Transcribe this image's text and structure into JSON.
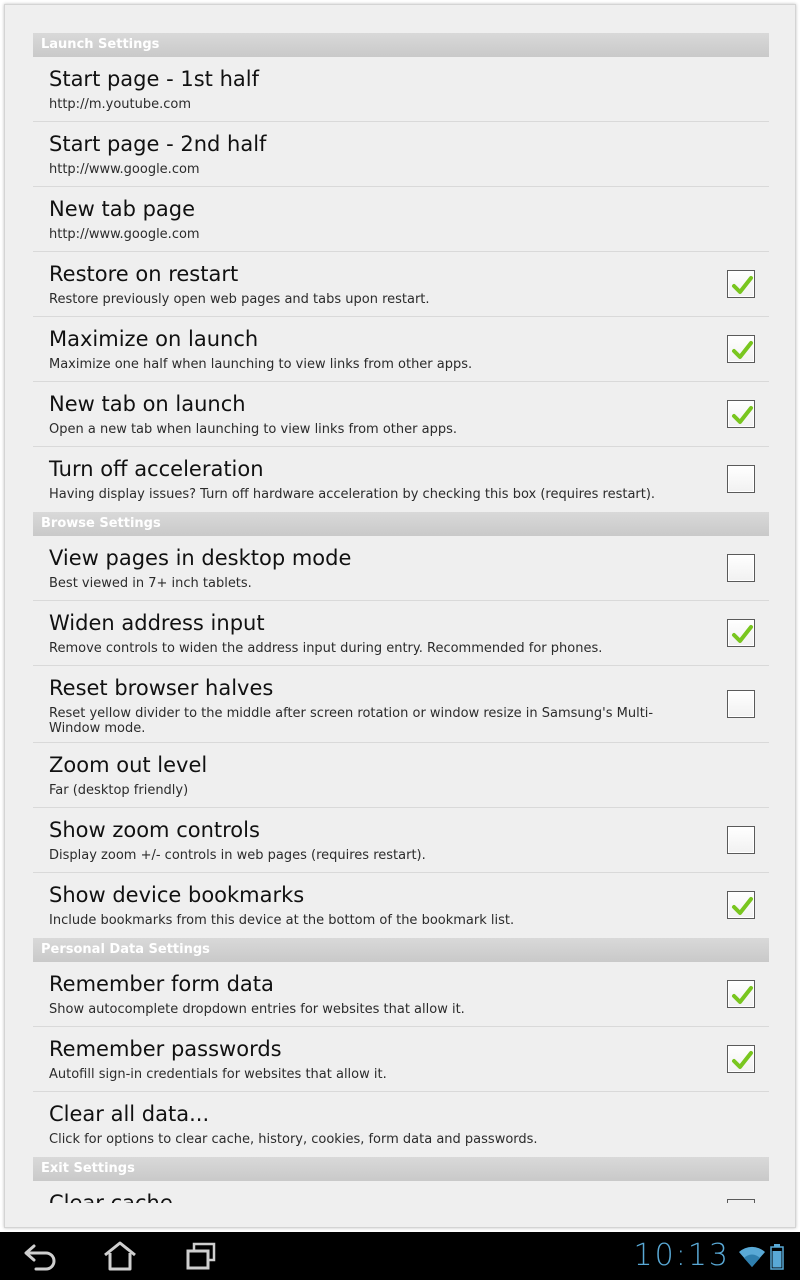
{
  "sections": [
    {
      "key": "launch",
      "header": "Launch Settings",
      "prefs": [
        {
          "title": "Start page - 1st half",
          "summary": "http://m.youtube.com",
          "checkbox": null
        },
        {
          "title": "Start page - 2nd half",
          "summary": "http://www.google.com",
          "checkbox": null
        },
        {
          "title": "New tab page",
          "summary": "http://www.google.com",
          "checkbox": null
        },
        {
          "title": "Restore on restart",
          "summary": "Restore previously open web pages and tabs upon restart.",
          "checkbox": true
        },
        {
          "title": "Maximize on launch",
          "summary": "Maximize one half when launching to view links from other apps.",
          "checkbox": true
        },
        {
          "title": "New tab on launch",
          "summary": "Open a new tab when launching to view links from other apps.",
          "checkbox": true
        },
        {
          "title": "Turn off acceleration",
          "summary": "Having display issues? Turn off hardware acceleration by checking this box (requires restart).",
          "checkbox": false
        }
      ]
    },
    {
      "key": "browse",
      "header": "Browse Settings",
      "prefs": [
        {
          "title": "View pages in desktop mode",
          "summary": "Best viewed in 7+ inch tablets.",
          "checkbox": false
        },
        {
          "title": "Widen address input",
          "summary": "Remove controls to widen the address input during entry. Recommended for phones.",
          "checkbox": true
        },
        {
          "title": "Reset browser halves",
          "summary": "Reset yellow divider to the middle after screen rotation or window resize in Samsung's Multi-Window mode.",
          "checkbox": false
        },
        {
          "title": "Zoom out level",
          "summary": "Far (desktop friendly)",
          "checkbox": null
        },
        {
          "title": "Show zoom controls",
          "summary": "Display zoom +/- controls in web pages (requires restart).",
          "checkbox": false
        },
        {
          "title": "Show device bookmarks",
          "summary": "Include bookmarks from this device at the bottom of the bookmark list.",
          "checkbox": true
        }
      ]
    },
    {
      "key": "personal",
      "header": "Personal Data Settings",
      "prefs": [
        {
          "title": "Remember form data",
          "summary": "Show autocomplete dropdown entries for websites that allow it.",
          "checkbox": true
        },
        {
          "title": "Remember passwords",
          "summary": "Autofill sign-in credentials for websites that allow it.",
          "checkbox": true
        },
        {
          "title": "Clear all data...",
          "summary": "Click for options to clear cache, history, cookies, form data and passwords.",
          "checkbox": null
        }
      ]
    },
    {
      "key": "exit",
      "header": "Exit Settings",
      "prefs": []
    }
  ],
  "partial_item": {
    "title": "Clear cache"
  },
  "system_bar": {
    "clock": "10:13",
    "accent_color": "#59a9d6",
    "buttons": [
      "back-icon",
      "home-icon",
      "recent-apps-icon"
    ],
    "status_icons": [
      "wifi-icon",
      "battery-icon"
    ]
  },
  "colors": {
    "check_green": "#79c61f",
    "section_header_bg": "#cdcdcd",
    "panel_bg": "#efefef"
  }
}
